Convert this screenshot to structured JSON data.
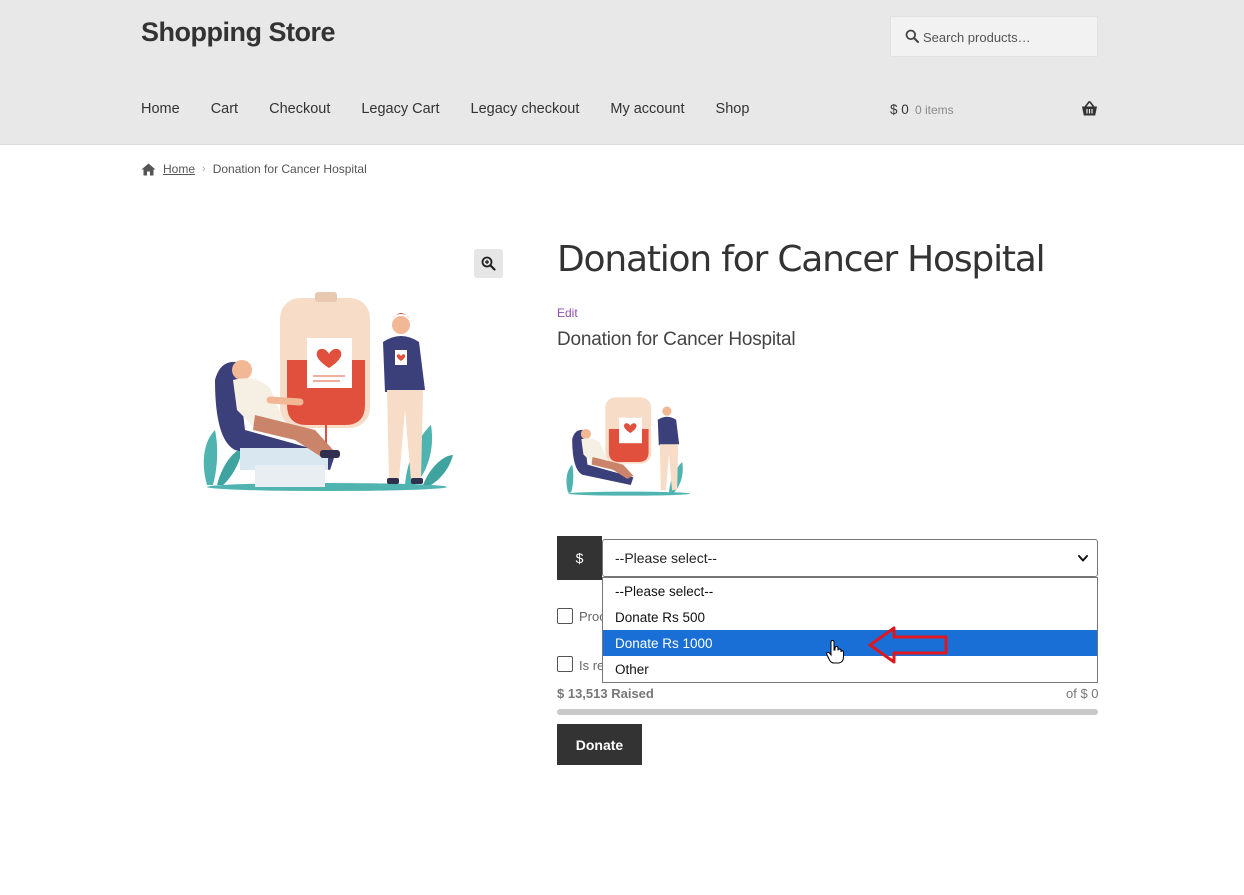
{
  "header": {
    "site_title": "Shopping Store",
    "search_placeholder": "Search products…",
    "nav": [
      "Home",
      "Cart",
      "Checkout",
      "Legacy Cart",
      "Legacy checkout",
      "My account",
      "Shop"
    ],
    "cart_amount": "$ 0",
    "cart_items": "0 items"
  },
  "breadcrumb": {
    "home": "Home",
    "current": "Donation for Cancer Hospital"
  },
  "product": {
    "title": "Donation for Cancer Hospital",
    "edit_label": "Edit",
    "subtitle": "Donation for Cancer Hospital"
  },
  "donation_form": {
    "currency_symbol": "$",
    "select_value": "--Please select--",
    "options": [
      "--Please select--",
      "Donate Rs 500",
      "Donate Rs 1000",
      "Other"
    ],
    "highlighted_option": "Donate Rs 1000",
    "checkbox_1_label": "Proc",
    "checkbox_2_label": "Is re",
    "raised_text": "$ 13,513 Raised",
    "goal_text": "of $ 0",
    "donate_label": "Donate"
  },
  "colors": {
    "header_bg": "#e8e8e8",
    "dark_button": "#333333",
    "highlight": "#1a6fd6",
    "edit_link": "#8f4fb0",
    "annotation_arrow": "#e0161f"
  },
  "icons": {
    "search": "search-icon",
    "basket": "basket-icon",
    "home": "home-icon",
    "zoom": "zoom-in-icon",
    "chevron": "chevron-down-icon",
    "cursor": "hand-pointer-icon",
    "arrow": "left-arrow-annotation-icon"
  }
}
